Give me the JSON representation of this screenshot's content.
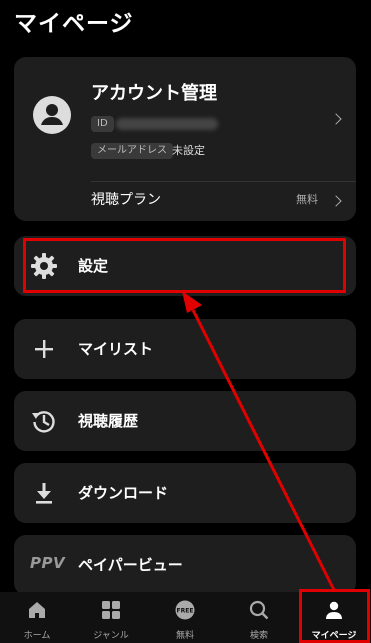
{
  "page": {
    "title": "マイページ"
  },
  "account": {
    "title": "アカウント管理",
    "id_label": "ID",
    "mail_label": "メールアドレス",
    "mail_status": "未設定",
    "plan_label": "視聴プラン",
    "plan_value": "無料"
  },
  "menu": {
    "settings": "設定",
    "mylist": "マイリスト",
    "history": "視聴履歴",
    "download": "ダウンロード",
    "ppv_label": "ペイパービュー",
    "ppv_icon_text": "PPV"
  },
  "tabs": {
    "home": "ホーム",
    "genre": "ジャンル",
    "free": "無料",
    "free_icon_text": "FREE",
    "search": "検索",
    "mypage": "マイページ"
  },
  "colors": {
    "highlight": "#e00000",
    "background": "#000000",
    "card": "#1e1e1e"
  }
}
